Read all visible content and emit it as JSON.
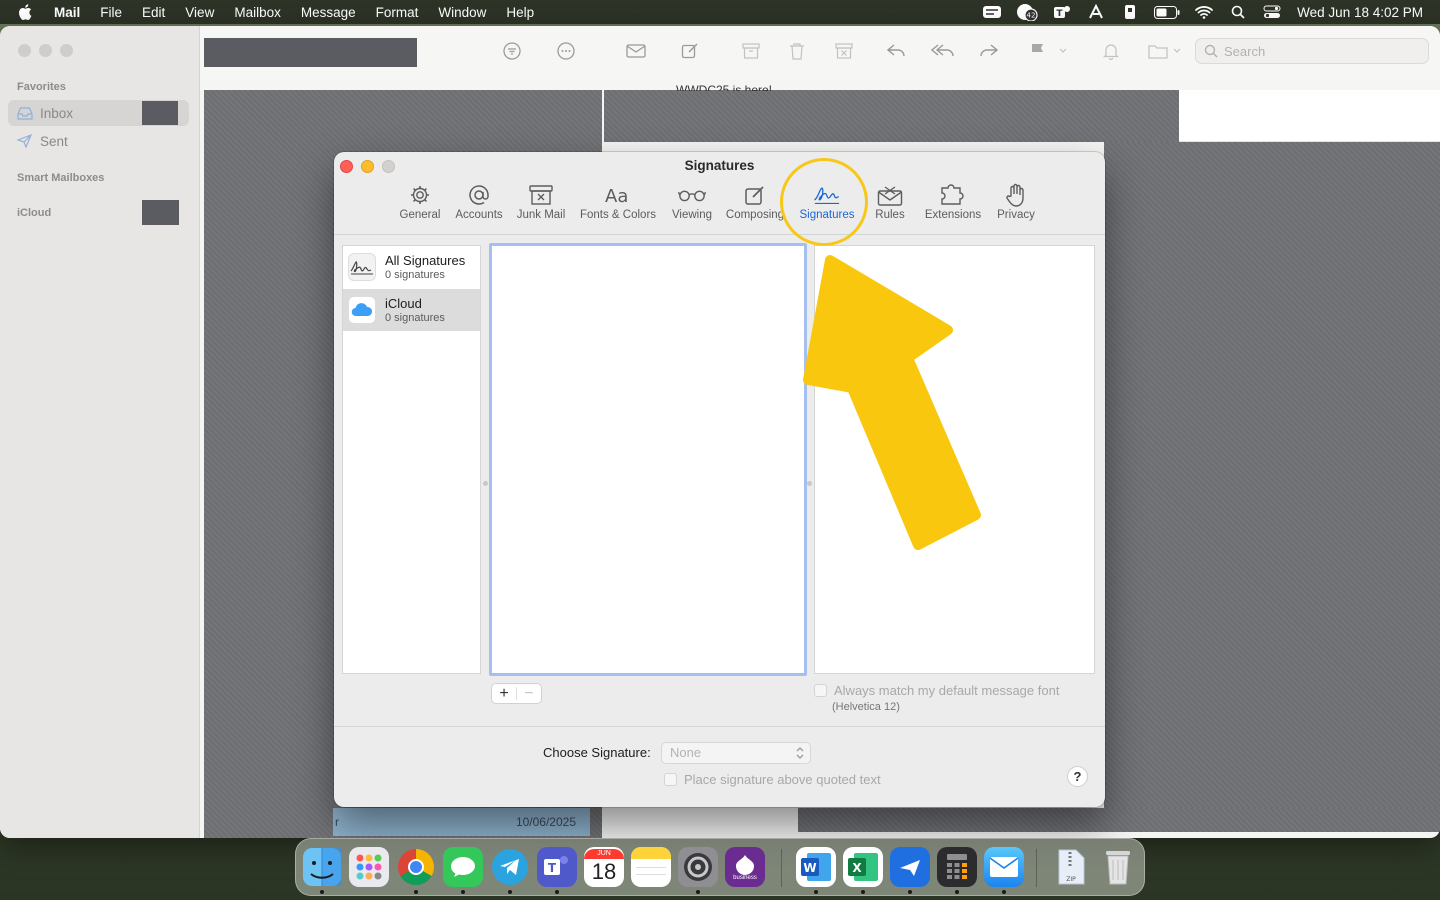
{
  "menubar": {
    "app_name": "Mail",
    "items": [
      "File",
      "Edit",
      "View",
      "Mailbox",
      "Message",
      "Format",
      "Window",
      "Help"
    ],
    "badge_count": "42",
    "clock": "Wed Jun 18  4:02 PM"
  },
  "mail_sidebar": {
    "favorites_header": "Favorites",
    "inbox_label": "Inbox",
    "sent_label": "Sent",
    "smart_mailboxes_header": "Smart Mailboxes",
    "icloud_header": "iCloud"
  },
  "mail_toolbar": {
    "search_placeholder": "Search"
  },
  "background_peek": {
    "message_subject": "WWDC25 is here!",
    "list_row_date": "10/06/2025",
    "list_row_fragment": "r"
  },
  "prefs": {
    "title": "Signatures",
    "tabs": [
      {
        "label": "General",
        "icon": "gear-icon"
      },
      {
        "label": "Accounts",
        "icon": "at-icon"
      },
      {
        "label": "Junk Mail",
        "icon": "junk-tray-icon"
      },
      {
        "label": "Fonts & Colors",
        "icon": "font-aa-icon"
      },
      {
        "label": "Viewing",
        "icon": "glasses-icon"
      },
      {
        "label": "Composing",
        "icon": "compose-icon"
      },
      {
        "label": "Signatures",
        "icon": "signature-icon"
      },
      {
        "label": "Rules",
        "icon": "rules-envelope-icon"
      },
      {
        "label": "Extensions",
        "icon": "puzzle-icon"
      },
      {
        "label": "Privacy",
        "icon": "hand-icon"
      }
    ],
    "active_tab": "Signatures",
    "accounts": [
      {
        "name": "All Signatures",
        "count": "0 signatures",
        "icon": "signature-icon"
      },
      {
        "name": "iCloud",
        "count": "0 signatures",
        "icon": "icloud-icon"
      }
    ],
    "add_button": "+",
    "remove_button": "−",
    "match_font_label": "Always match my default message font",
    "font_note": "(Helvetica 12)",
    "choose_signature_label": "Choose Signature:",
    "choose_signature_value": "None",
    "place_above_label": "Place signature above quoted text",
    "help_label": "?"
  },
  "annotation": {
    "highlight_color": "#f7c818",
    "arrow_color": "#f9c80e"
  },
  "dock": {
    "apps": [
      "Finder",
      "Launchpad",
      "Google Chrome",
      "Messages",
      "Telegram",
      "Microsoft Teams",
      "Calendar",
      "Notes",
      "System Settings",
      "Splashtop Business",
      "Microsoft Word",
      "Microsoft Excel",
      "Unknown App",
      "Calculator",
      "Mail",
      "Archive",
      "Trash"
    ],
    "calendar_month": "JUN",
    "calendar_day": "18",
    "splashtop_caption": "business",
    "archive_caption": "ZIP"
  }
}
